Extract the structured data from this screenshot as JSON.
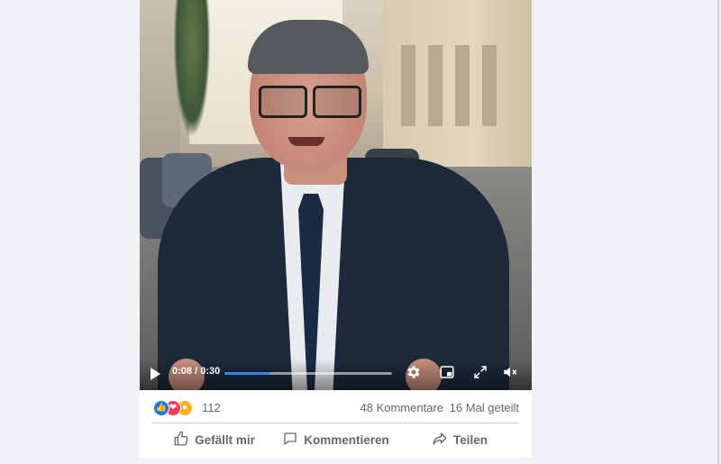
{
  "video": {
    "current_time": "0:08",
    "duration": "0:30",
    "time_separator": "/",
    "progress_fraction": 0.27,
    "accent_color": "#3b82f6"
  },
  "stats": {
    "reaction_icons": [
      "like-icon",
      "love-icon",
      "wow-icon"
    ],
    "reaction_count": "112",
    "comments": "48 Kommentare",
    "shares": "16 Mal geteilt"
  },
  "actions": {
    "like_label": "Gefällt mir",
    "comment_label": "Kommentieren",
    "share_label": "Teilen"
  },
  "colors": {
    "page_bg": "#f0f2f5",
    "card_bg": "#ffffff",
    "muted_text": "#65676b",
    "like_blue": "#1877f2",
    "love_red": "#f33e58",
    "wow_yellow": "#f7b125"
  }
}
